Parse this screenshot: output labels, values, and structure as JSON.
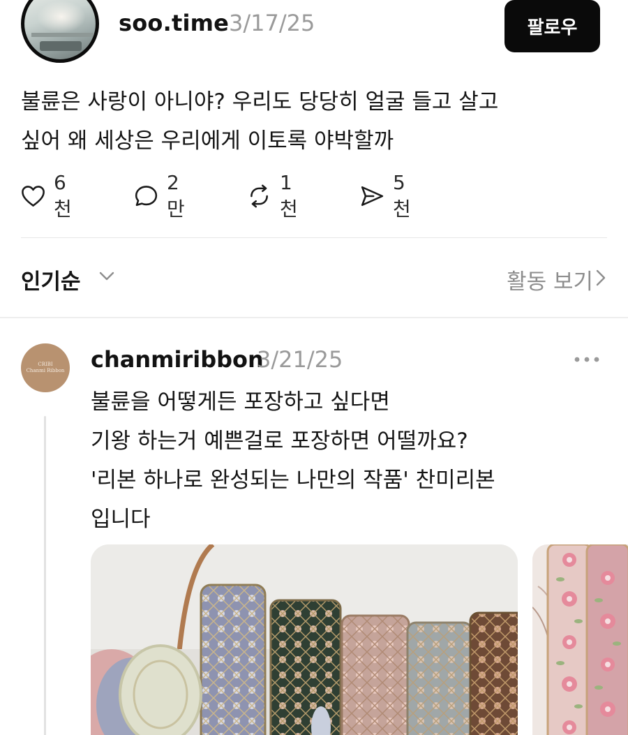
{
  "post": {
    "author": "soo.time",
    "date": "3/17/25",
    "follow_label": "팔로우",
    "body_lines": [
      "불륜은 사랑이 아니야? 우리도 당당히 얼굴 들고 살고",
      "싶어 왜 세상은 우리에게 이토록 야박할까"
    ],
    "actions": [
      {
        "icon": "heart-icon",
        "count": "6천"
      },
      {
        "icon": "comment-icon",
        "count": "2만"
      },
      {
        "icon": "repost-icon",
        "count": "1천"
      },
      {
        "icon": "share-icon",
        "count": "5천"
      }
    ]
  },
  "sort": {
    "label": "인기순",
    "activity_label": "활동 보기"
  },
  "reply": {
    "author": "chanmiribbon",
    "date": "3/21/25",
    "avatar_text": [
      "CRIBI",
      "Chanmi Ribbon"
    ],
    "body_lines": [
      "불륜을 어떻게든 포장하고 싶다면",
      "기왕 하는거 예쁜걸로 포장하면 어떨까요?",
      "'리본 하나로 완성되는 나만의 작품' 찬미리본",
      "입니다"
    ]
  },
  "colors": {
    "text": "#141414",
    "muted": "#9a9a9a",
    "follow_bg": "#0a0a0a",
    "divider": "#e6e6e6"
  }
}
